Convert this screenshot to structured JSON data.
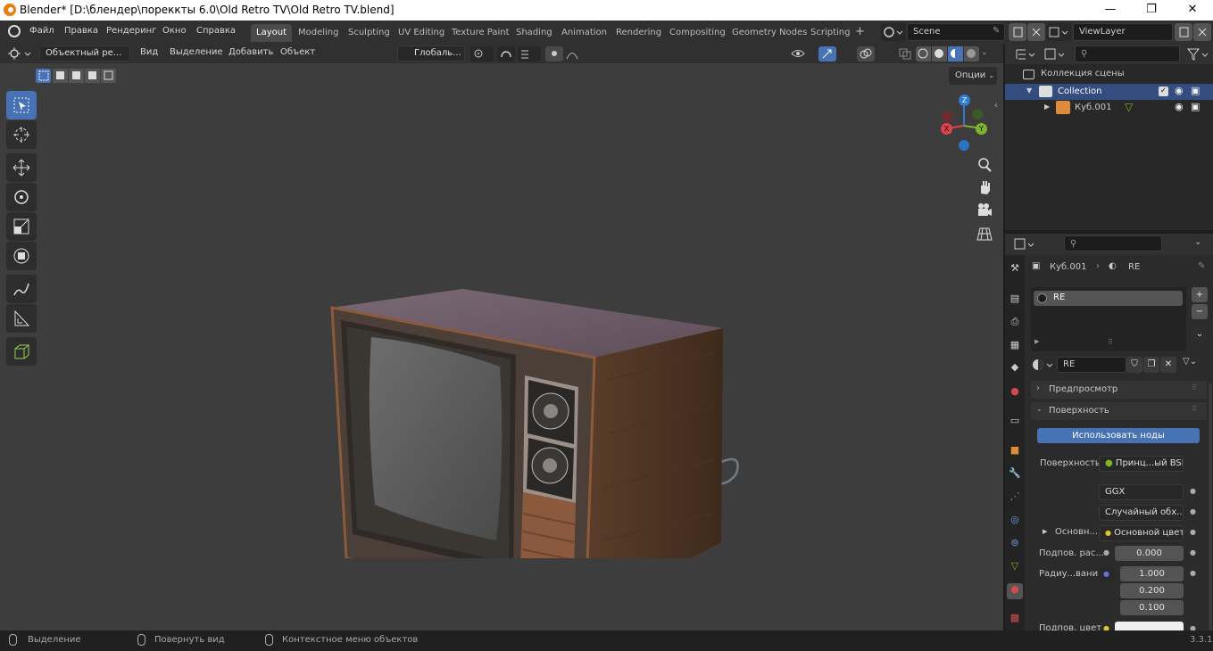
{
  "titlebar": {
    "title": "Blender* [D:\\блендер\\пореккты 6.0\\Old Retro TV\\Old Retro TV.blend]",
    "minimize": "—",
    "maximize": "❐",
    "close": "✕"
  },
  "menu": {
    "file": "Файл",
    "edit": "Правка",
    "render": "Рендеринг",
    "window": "Окно",
    "help": "Справка"
  },
  "workspaces": [
    "Layout",
    "Modeling",
    "Sculpting",
    "UV Editing",
    "Texture Paint",
    "Shading",
    "Animation",
    "Rendering",
    "Compositing",
    "Geometry Nodes",
    "Scripting"
  ],
  "active_workspace": "Layout",
  "scene": {
    "name": "Scene"
  },
  "view_layer": {
    "name": "ViewLayer"
  },
  "viewport_header": {
    "mode": "Объектный ре...",
    "view": "Вид",
    "select": "Выделение",
    "add": "Добавить",
    "object": "Объект",
    "transform_orientation": "Глобаль...",
    "options": "Опции"
  },
  "gizmo": {
    "z": "Z",
    "y": "Y",
    "x": "X"
  },
  "outliner": {
    "scene_collection": "Коллекция сцены",
    "collection": "Collection",
    "object": "Куб.001"
  },
  "properties": {
    "breadcrumb_object": "Куб.001",
    "breadcrumb_material": "RE",
    "slot_material": "RE",
    "material_name": "RE",
    "preview_panel": "Предпросмотр",
    "surface_panel": "Поверхность",
    "use_nodes": "Использовать ноды",
    "surface_label": "Поверхность",
    "surface_shader": "Принц...ый BSDF",
    "distribution": "GGX",
    "subsurface_method": "Случайный обх...",
    "base_color_label": "Основн...",
    "base_color_value": "Основной цвет",
    "subsurface_label": "Подпов. рас...",
    "subsurface_value": "0.000",
    "radius_label": "Радиу...вания",
    "radius_values": [
      "1.000",
      "0.200",
      "0.100"
    ],
    "subsurface_color_label": "Подпов. цвет"
  },
  "status": {
    "select": "Выделение",
    "rotate": "Повернуть вид",
    "context": "Контекстное меню объектов",
    "version": "3.3.1"
  },
  "colors": {
    "accent": "#4772b3",
    "axis_x": "#e0424b",
    "axis_y": "#7ab52a",
    "axis_z": "#2e7bd6",
    "viewport_bg": "#3d3d3d"
  }
}
